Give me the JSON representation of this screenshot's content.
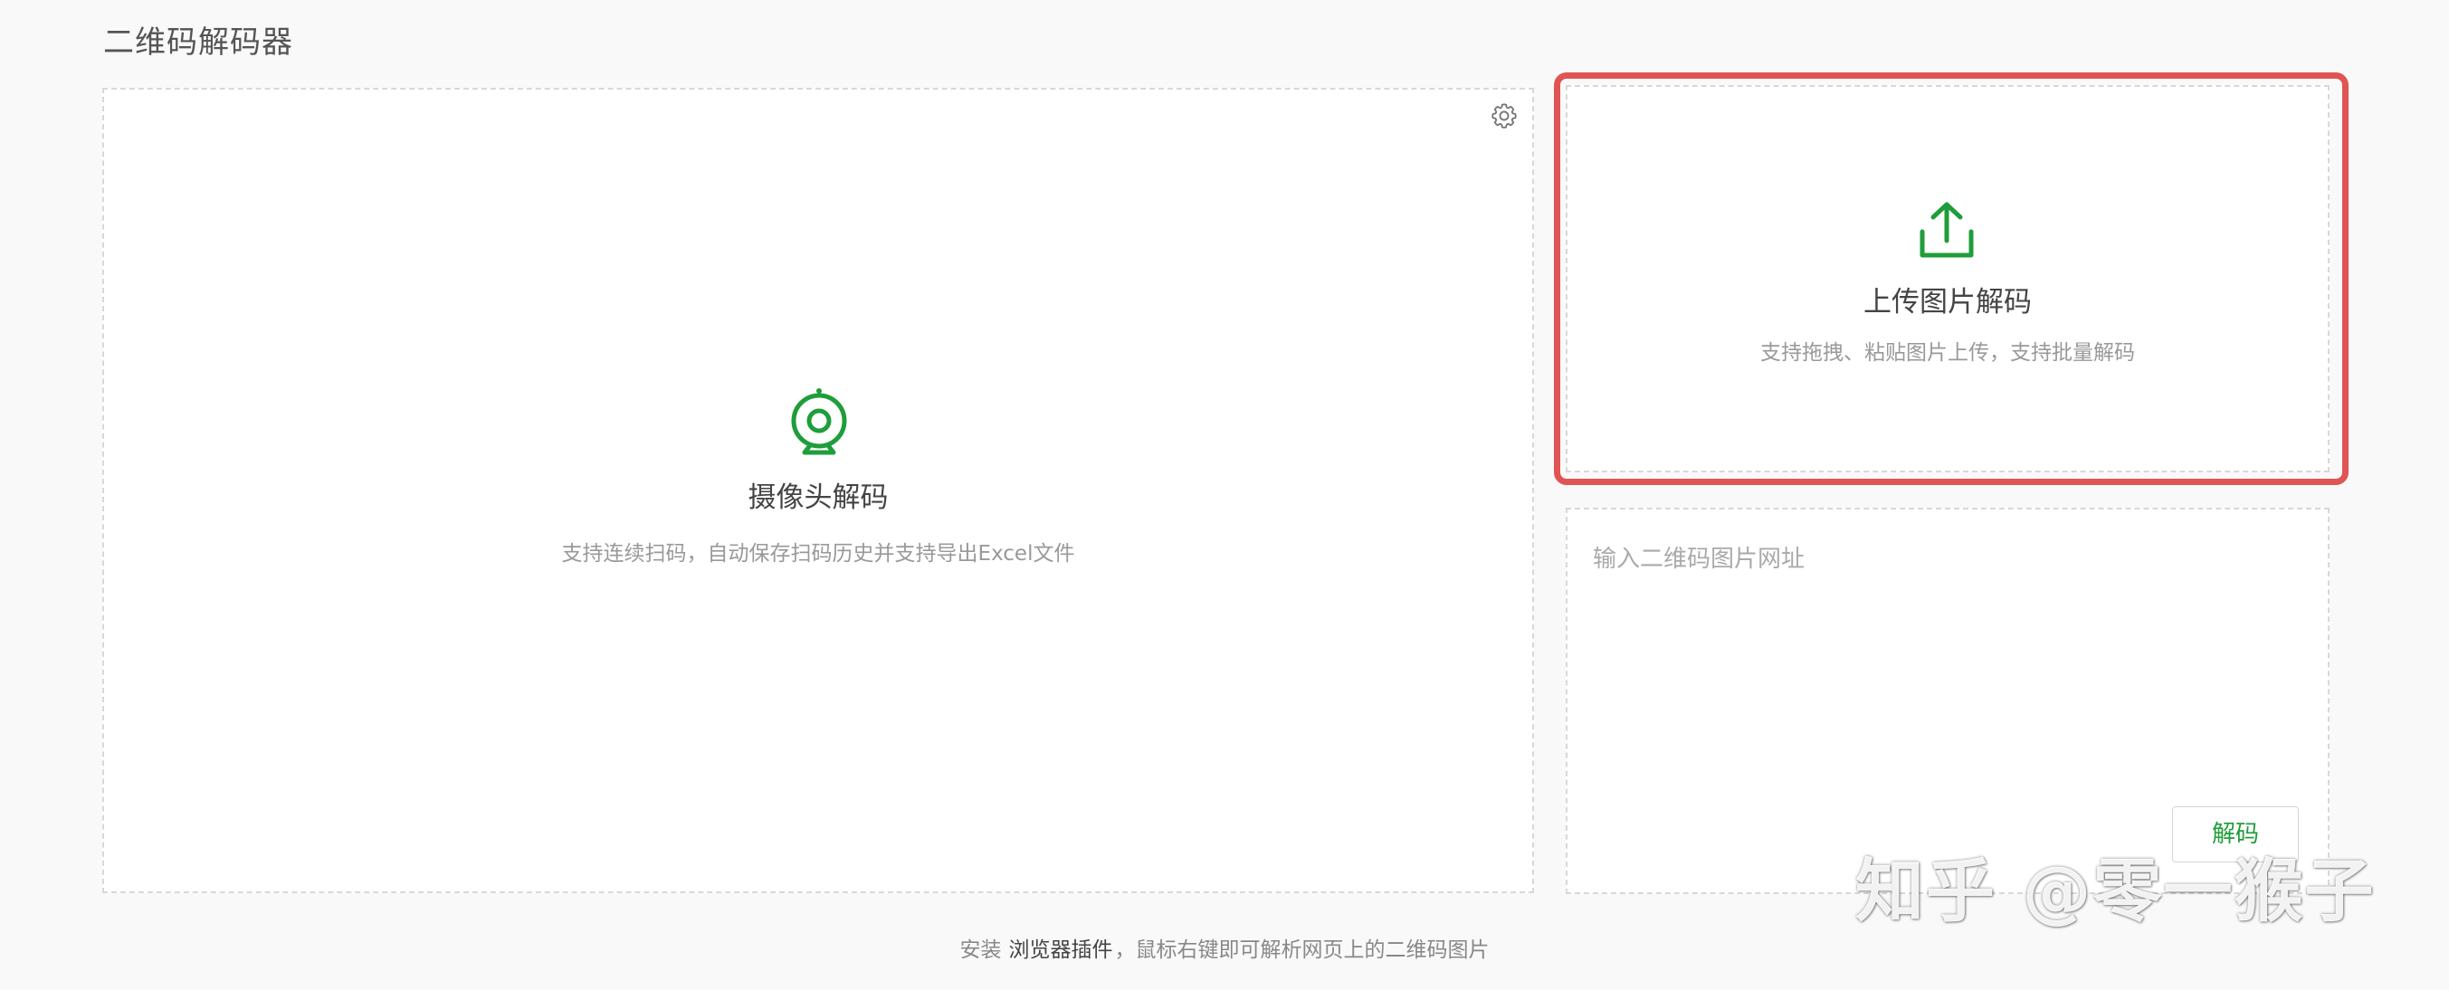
{
  "page": {
    "title": "二维码解码器"
  },
  "camera": {
    "title": "摄像头解码",
    "description": "支持连续扫码，自动保存扫码历史并支持导出Excel文件",
    "settings_icon": "gear-icon",
    "icon": "webcam-icon"
  },
  "upload": {
    "title": "上传图片解码",
    "description": "支持拖拽、粘贴图片上传，支持批量解码",
    "icon": "upload-icon",
    "highlight_color": "#e05454"
  },
  "url_decode": {
    "placeholder": "输入二维码图片网址",
    "value": "",
    "button_label": "解码"
  },
  "footer": {
    "prefix": "安装",
    "link_label": "浏览器插件",
    "suffix": "，鼠标右键即可解析网页上的二维码图片"
  },
  "watermark": {
    "text": "知乎 @零一猴子"
  },
  "colors": {
    "accent": "#1f9d3a",
    "background": "#f9f9f9",
    "panel": "#ffffff",
    "border": "#d8d8d8"
  }
}
